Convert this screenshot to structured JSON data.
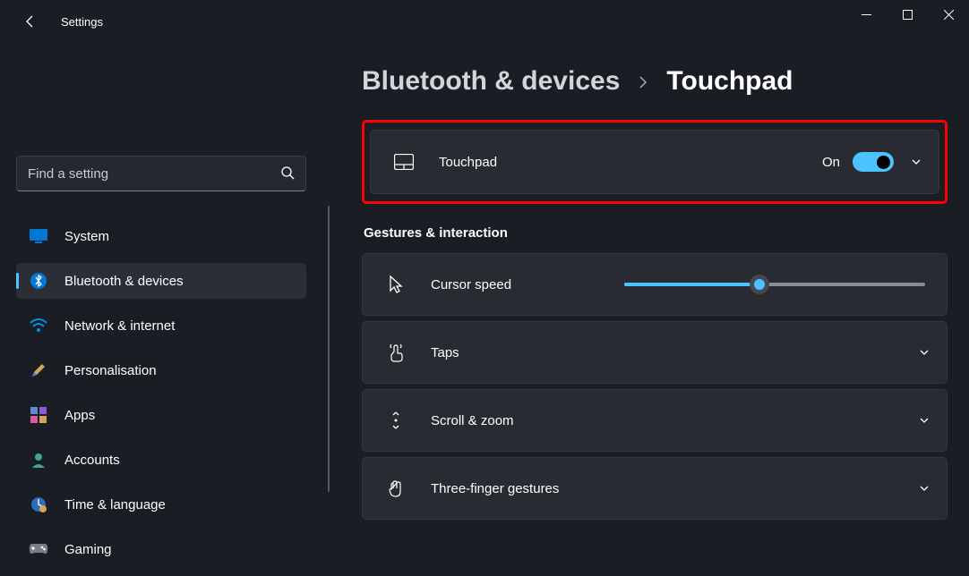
{
  "app": {
    "title": "Settings"
  },
  "search": {
    "placeholder": "Find a setting"
  },
  "sidebar": {
    "items": [
      {
        "label": "System"
      },
      {
        "label": "Bluetooth & devices"
      },
      {
        "label": "Network & internet"
      },
      {
        "label": "Personalisation"
      },
      {
        "label": "Apps"
      },
      {
        "label": "Accounts"
      },
      {
        "label": "Time & language"
      },
      {
        "label": "Gaming"
      }
    ],
    "active_index": 1
  },
  "breadcrumb": {
    "parent": "Bluetooth & devices",
    "current": "Touchpad"
  },
  "touchpad_row": {
    "label": "Touchpad",
    "toggle_state": "On"
  },
  "section_heading": "Gestures & interaction",
  "rows": {
    "cursor_speed": {
      "label": "Cursor speed",
      "value_pct": 45
    },
    "taps": {
      "label": "Taps"
    },
    "scroll": {
      "label": "Scroll & zoom"
    },
    "three_finger": {
      "label": "Three-finger gestures"
    }
  },
  "colors": {
    "accent": "#4cc2ff",
    "highlight_border": "#ff0000"
  }
}
